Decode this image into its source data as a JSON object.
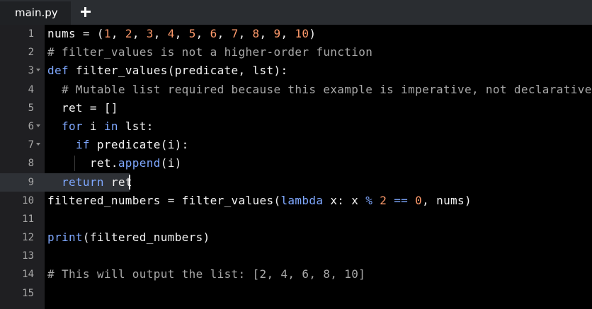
{
  "tabs": [
    {
      "label": "main.py",
      "active": true
    }
  ],
  "add_tab_icon": "plus-icon",
  "editor": {
    "active_line": 9,
    "lines": [
      {
        "n": "1",
        "fold": false,
        "tokens": [
          {
            "t": "nums = (",
            "c": "txt"
          },
          {
            "t": "1",
            "c": "num"
          },
          {
            "t": ", ",
            "c": "txt"
          },
          {
            "t": "2",
            "c": "num"
          },
          {
            "t": ", ",
            "c": "txt"
          },
          {
            "t": "3",
            "c": "num"
          },
          {
            "t": ", ",
            "c": "txt"
          },
          {
            "t": "4",
            "c": "num"
          },
          {
            "t": ", ",
            "c": "txt"
          },
          {
            "t": "5",
            "c": "num"
          },
          {
            "t": ", ",
            "c": "txt"
          },
          {
            "t": "6",
            "c": "num"
          },
          {
            "t": ", ",
            "c": "txt"
          },
          {
            "t": "7",
            "c": "num"
          },
          {
            "t": ", ",
            "c": "txt"
          },
          {
            "t": "8",
            "c": "num"
          },
          {
            "t": ", ",
            "c": "txt"
          },
          {
            "t": "9",
            "c": "num"
          },
          {
            "t": ", ",
            "c": "txt"
          },
          {
            "t": "10",
            "c": "num"
          },
          {
            "t": ")",
            "c": "txt"
          }
        ]
      },
      {
        "n": "2",
        "fold": false,
        "tokens": [
          {
            "t": "# filter_values is not a higher-order function",
            "c": "cmt"
          }
        ]
      },
      {
        "n": "3",
        "fold": true,
        "tokens": [
          {
            "t": "def ",
            "c": "kw"
          },
          {
            "t": "filter_values(predicate, lst):",
            "c": "txt"
          }
        ]
      },
      {
        "n": "4",
        "fold": false,
        "tokens": [
          {
            "t": "  ",
            "c": "txt"
          },
          {
            "t": "# Mutable list required because this example is imperative, not declarative",
            "c": "cmt"
          }
        ]
      },
      {
        "n": "5",
        "fold": false,
        "tokens": [
          {
            "t": "  ret = []",
            "c": "txt"
          }
        ]
      },
      {
        "n": "6",
        "fold": true,
        "tokens": [
          {
            "t": "  ",
            "c": "txt"
          },
          {
            "t": "for ",
            "c": "kw"
          },
          {
            "t": "i ",
            "c": "txt"
          },
          {
            "t": "in ",
            "c": "kw"
          },
          {
            "t": "lst:",
            "c": "txt"
          }
        ]
      },
      {
        "n": "7",
        "fold": true,
        "tokens": [
          {
            "t": "    ",
            "c": "txt"
          },
          {
            "t": "if ",
            "c": "kw"
          },
          {
            "t": "predicate(i):",
            "c": "txt"
          }
        ]
      },
      {
        "n": "8",
        "fold": false,
        "tokens": [
          {
            "t": "      ret.",
            "c": "txt"
          },
          {
            "t": "append",
            "c": "fn"
          },
          {
            "t": "(i)",
            "c": "txt"
          }
        ]
      },
      {
        "n": "9",
        "fold": false,
        "tokens": [
          {
            "t": "  ",
            "c": "txt"
          },
          {
            "t": "return ",
            "c": "kw"
          },
          {
            "t": "ret",
            "c": "txt"
          }
        ]
      },
      {
        "n": "10",
        "fold": false,
        "tokens": [
          {
            "t": "filtered_numbers = filter_values(",
            "c": "txt"
          },
          {
            "t": "lambda ",
            "c": "kw"
          },
          {
            "t": "x: x ",
            "c": "txt"
          },
          {
            "t": "%",
            "c": "op"
          },
          {
            "t": " ",
            "c": "txt"
          },
          {
            "t": "2",
            "c": "num"
          },
          {
            "t": " ",
            "c": "txt"
          },
          {
            "t": "==",
            "c": "op"
          },
          {
            "t": " ",
            "c": "txt"
          },
          {
            "t": "0",
            "c": "num"
          },
          {
            "t": ", nums)",
            "c": "txt"
          }
        ]
      },
      {
        "n": "11",
        "fold": false,
        "tokens": []
      },
      {
        "n": "12",
        "fold": false,
        "tokens": [
          {
            "t": "print",
            "c": "fn"
          },
          {
            "t": "(filtered_numbers)",
            "c": "txt"
          }
        ]
      },
      {
        "n": "13",
        "fold": false,
        "tokens": []
      },
      {
        "n": "14",
        "fold": false,
        "tokens": [
          {
            "t": "# This will output the list: [2, 4, 6, 8, 10]",
            "c": "cmt"
          }
        ]
      },
      {
        "n": "15",
        "fold": false,
        "tokens": []
      }
    ]
  },
  "colors": {
    "background": "#000000",
    "gutter": "#1f1f22",
    "tabbar": "#2a2d31",
    "keyword": "#7fa8ff",
    "number": "#ff9a6b",
    "comment": "#a8a8a8",
    "text": "#f2f2f2"
  }
}
